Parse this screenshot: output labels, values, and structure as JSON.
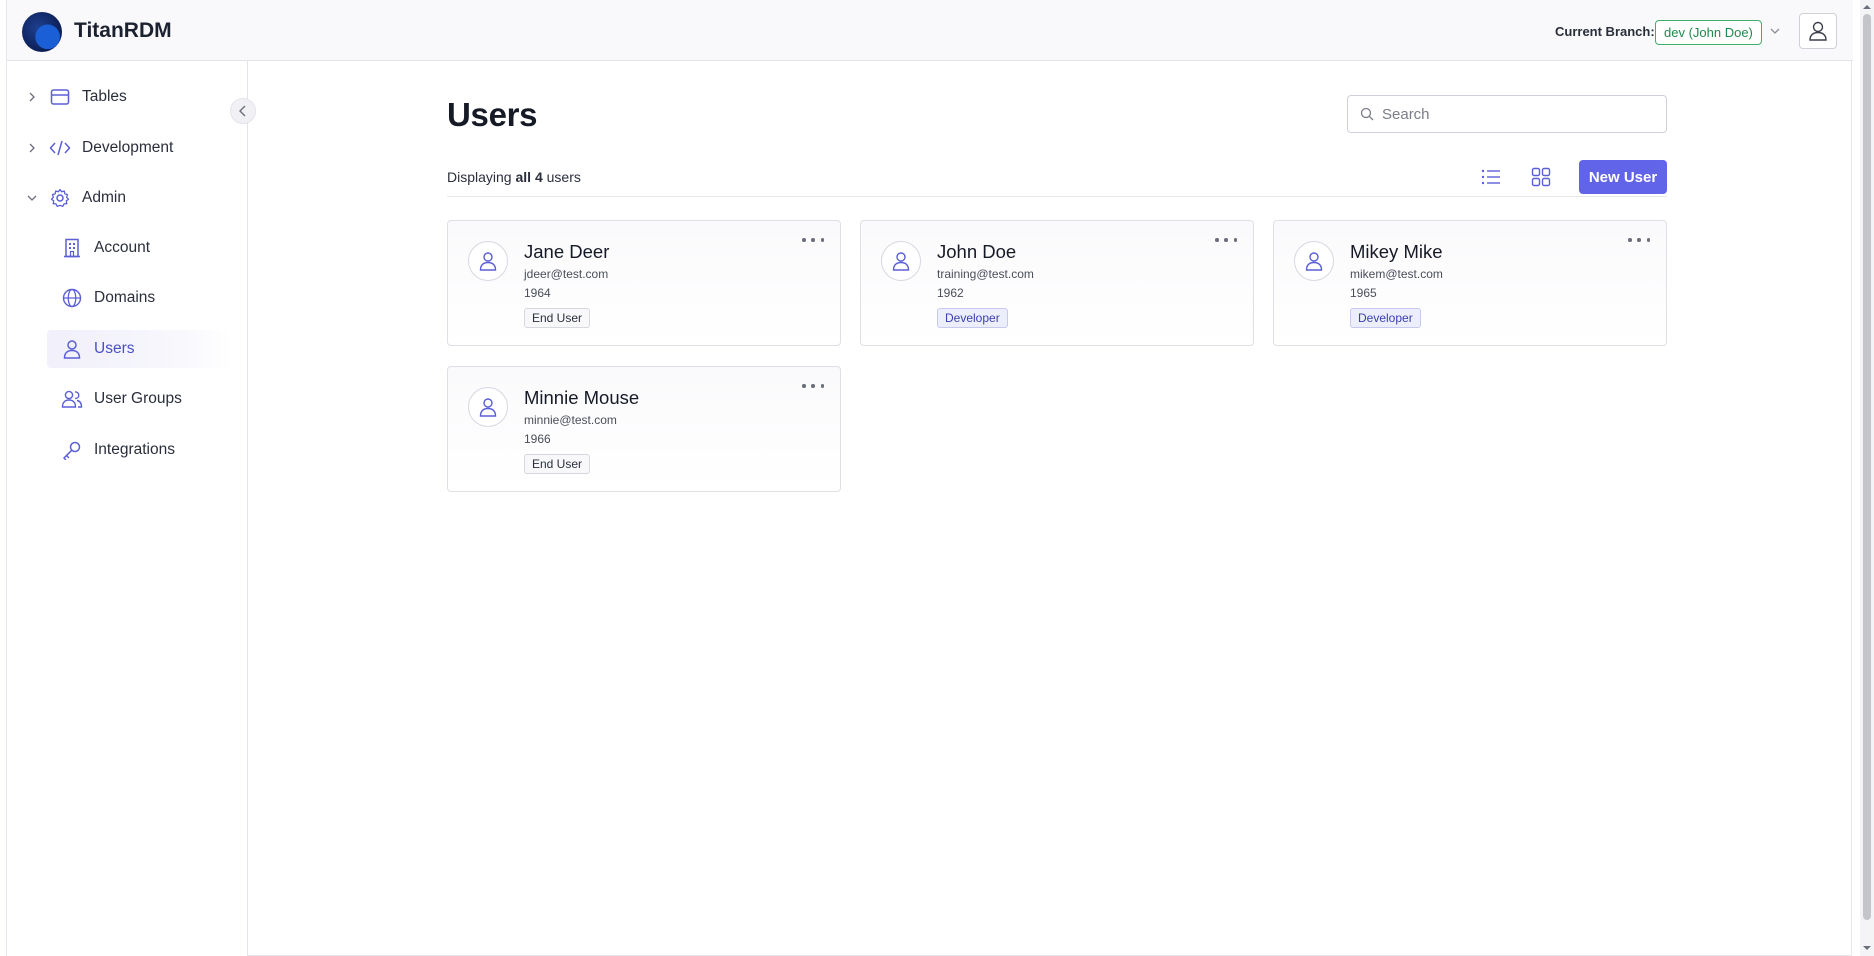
{
  "app": {
    "name": "TitanRDM"
  },
  "header": {
    "branch_label": "Current Branch:",
    "branch_value": "dev (John Doe)"
  },
  "sidebar": {
    "sections": [
      {
        "label": "Tables",
        "icon": "table-icon",
        "expanded": false
      },
      {
        "label": "Development",
        "icon": "code-icon",
        "expanded": false
      },
      {
        "label": "Admin",
        "icon": "gear-icon",
        "expanded": true
      }
    ],
    "children": [
      {
        "label": "Account",
        "icon": "building-icon",
        "active": false
      },
      {
        "label": "Domains",
        "icon": "globe-icon",
        "active": false
      },
      {
        "label": "Users",
        "icon": "user-icon",
        "active": true
      },
      {
        "label": "User Groups",
        "icon": "users-icon",
        "active": false
      },
      {
        "label": "Integrations",
        "icon": "key-icon",
        "active": false
      }
    ]
  },
  "main": {
    "title": "Users",
    "search_placeholder": "Search",
    "display_prefix": "Displaying",
    "display_bold": "all 4",
    "display_suffix": "users",
    "new_user_label": "New User"
  },
  "users": [
    {
      "name": "Jane Deer",
      "email": "jdeer@test.com",
      "year": "1964",
      "role": "End User"
    },
    {
      "name": "John Doe",
      "email": "training@test.com",
      "year": "1962",
      "role": "Developer"
    },
    {
      "name": "Mikey Mike",
      "email": "mikem@test.com",
      "year": "1965",
      "role": "Developer"
    },
    {
      "name": "Minnie Mouse",
      "email": "minnie@test.com",
      "year": "1966",
      "role": "End User"
    }
  ],
  "colors": {
    "accent": "#6163e9",
    "branch_green": "#1f8a4c",
    "icon_purple": "#5b5fd6"
  }
}
